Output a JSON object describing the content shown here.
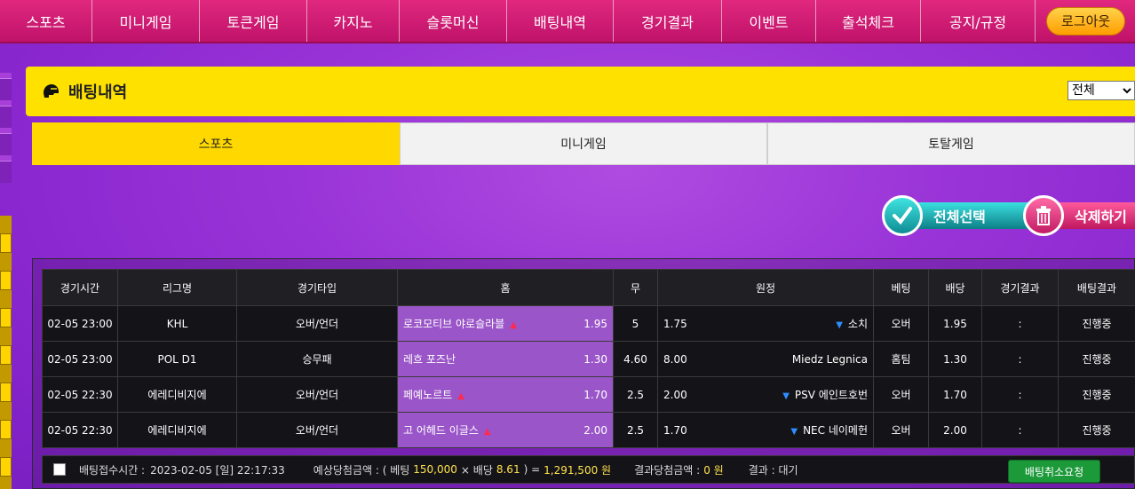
{
  "nav": {
    "items": [
      "스포츠",
      "미니게임",
      "토큰게임",
      "카지노",
      "슬롯머신",
      "배팅내역",
      "경기결과",
      "이벤트",
      "출석체크",
      "공지/규정"
    ],
    "logout": "로그아웃"
  },
  "banner": {
    "title": "배팅내역",
    "filter_value": "전체"
  },
  "tabs": [
    "스포츠",
    "미니게임",
    "토탈게임"
  ],
  "actions": {
    "select_all": "전체선택",
    "delete": "삭제하기"
  },
  "table": {
    "headers": [
      "경기시간",
      "리그명",
      "경기타입",
      "홈",
      "무",
      "원정",
      "베팅",
      "배당",
      "경기결과",
      "배팅결과"
    ],
    "rows": [
      {
        "time": "02-05 23:00",
        "league": "KHL",
        "type": "오버/언더",
        "home": "로코모티브 야로슬라블",
        "home_odds": "1.95",
        "draw": "5",
        "away_odds": "1.75",
        "away": "소치",
        "bet": "오버",
        "odds": "1.95",
        "result": ":",
        "status": "진행중"
      },
      {
        "time": "02-05 23:00",
        "league": "POL D1",
        "type": "승무패",
        "home": "레흐 포즈난",
        "home_odds": "1.30",
        "draw": "4.60",
        "away_odds": "8.00",
        "away": "Miedz Legnica",
        "bet": "홈팀",
        "odds": "1.30",
        "result": ":",
        "status": "진행중"
      },
      {
        "time": "02-05 22:30",
        "league": "에레디비지에",
        "type": "오버/언더",
        "home": "페예노르트",
        "home_odds": "1.70",
        "draw": "2.5",
        "away_odds": "2.00",
        "away": "PSV 에인트호번",
        "bet": "오버",
        "odds": "1.70",
        "result": ":",
        "status": "진행중"
      },
      {
        "time": "02-05 22:30",
        "league": "에레디비지에",
        "type": "오버/언더",
        "home": "고 어헤드 이글스",
        "home_odds": "2.00",
        "draw": "2.5",
        "away_odds": "1.70",
        "away": "NEC 네이메헌",
        "bet": "오버",
        "odds": "2.00",
        "result": ":",
        "status": "진행중"
      }
    ]
  },
  "footer": {
    "time_label": "배팅접수시간 :",
    "time_value": "2023-02-05 [일] 22:17:33",
    "expected_label": "예상당첨금액 : ( 베팅",
    "bet_amount": "150,000",
    "times": "× 배당",
    "total_odds": "8.61",
    "equals": ") =",
    "expected_amount": "1,291,500 원",
    "won_label": "결과당첨금액 :",
    "won_amount": "0 원",
    "result_label": "결과 : 대기",
    "cancel": "배팅취소요청"
  },
  "colors": {
    "nav": "#d91c74",
    "banner": "#ffe100",
    "tab_active": "#ffd800",
    "home_cell": "#9a55c8"
  }
}
